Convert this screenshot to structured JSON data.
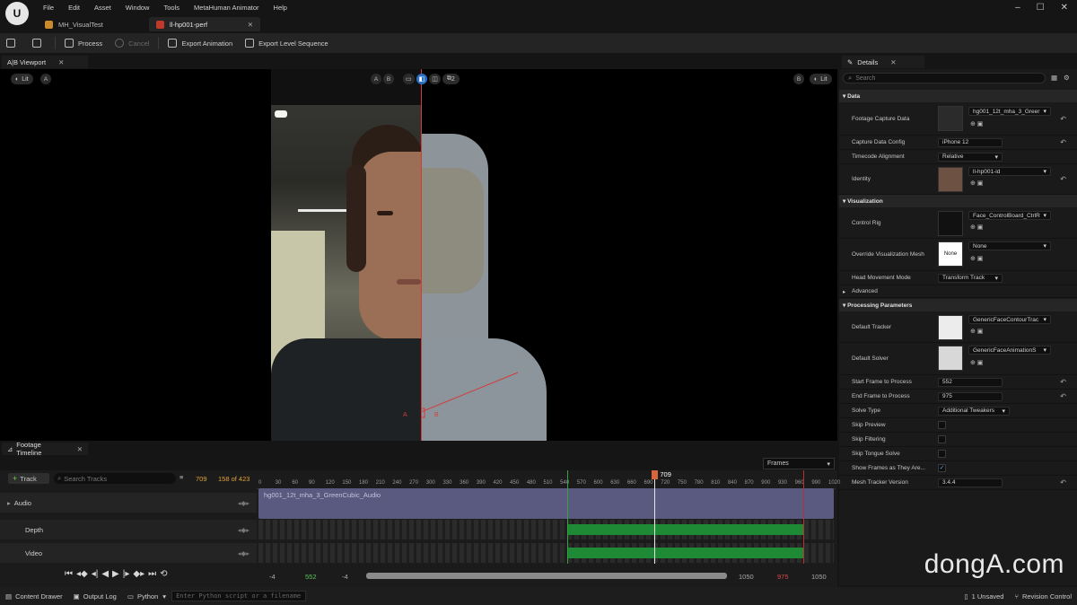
{
  "menu": [
    "File",
    "Edit",
    "Asset",
    "Window",
    "Tools",
    "MetaHuman Animator",
    "Help"
  ],
  "tabs": [
    {
      "label": "MH_VisualTest"
    },
    {
      "label": "ll-hp001-perf"
    }
  ],
  "toolbar": {
    "process": "Process",
    "cancel": "Cancel",
    "export_animation": "Export Animation",
    "export_level_sequence": "Export Level Sequence"
  },
  "viewport": {
    "tab_label": "A|B Viewport",
    "lit_left": "Lit",
    "badge_a": "A",
    "badge_b": "B",
    "ab_toggle_a": "A",
    "ab_toggle_b": "B",
    "camera_count": "2",
    "lit_right": "Lit",
    "marker_a": "A",
    "marker_b": "B"
  },
  "details": {
    "tab_label": "Details",
    "search_placeholder": "Search",
    "sections": {
      "data": "Data",
      "visualization": "Visualization",
      "advanced": "Advanced",
      "processing": "Processing Parameters"
    },
    "rows": {
      "footage_capture_data": {
        "label": "Footage Capture Data",
        "value": "hg001_12t_mha_3_Greer"
      },
      "capture_data_config": {
        "label": "Capture Data Config",
        "value": "iPhone 12"
      },
      "timecode_alignment": {
        "label": "Timecode Alignment",
        "value": "Relative"
      },
      "identity": {
        "label": "Identity",
        "value": "ll-hp001-id"
      },
      "control_rig": {
        "label": "Control Rig",
        "value": "Face_ControlBoard_CtrlR"
      },
      "override_mesh": {
        "label": "Override Visualization Mesh",
        "value": "None",
        "thumb": "None"
      },
      "head_movement": {
        "label": "Head Movement Mode",
        "value": "Transform Track"
      },
      "default_tracker": {
        "label": "Default Tracker",
        "value": "GenericFaceContourTrac"
      },
      "default_solver": {
        "label": "Default Solver",
        "value": "GenericFaceAnimationS"
      },
      "start_frame": {
        "label": "Start Frame to Process",
        "value": "552"
      },
      "end_frame": {
        "label": "End Frame to Process",
        "value": "975"
      },
      "solve_type": {
        "label": "Solve Type",
        "value": "Additional Tweakers"
      },
      "skip_preview": {
        "label": "Skip Preview"
      },
      "skip_filtering": {
        "label": "Skip Filtering"
      },
      "skip_tongue": {
        "label": "Skip Tongue Solve"
      },
      "show_frames": {
        "label": "Show Frames as They Are..."
      },
      "mesh_tracker_version": {
        "label": "Mesh Tracker Version",
        "value": "3.4.4"
      }
    }
  },
  "timeline": {
    "tab_label": "Footage Timeline",
    "add_track": "Track",
    "search_placeholder": "Search Tracks",
    "current_frame": "709",
    "frame_count": "158 of 423",
    "frames_dropdown": "Frames",
    "playhead": "709",
    "tracks": [
      {
        "label": "Audio"
      },
      {
        "label": "Depth"
      },
      {
        "label": "Video"
      }
    ],
    "audio_clip": "hg001_12t_mha_3_GreenCubic_Audio",
    "ruler": [
      "0",
      "30",
      "60",
      "90",
      "120",
      "150",
      "180",
      "210",
      "240",
      "270",
      "300",
      "330",
      "360",
      "390",
      "420",
      "450",
      "480",
      "510",
      "540",
      "570",
      "600",
      "630",
      "660",
      "690",
      "720",
      "750",
      "780",
      "810",
      "840",
      "870",
      "900",
      "930",
      "960",
      "990",
      "1020"
    ],
    "range_start_offset": "-4",
    "range_start": "552",
    "range_start_offset2": "-4",
    "range_end": "1050",
    "range_end_red": "975",
    "range_end2": "1050",
    "selection_start_frame": 552,
    "selection_end_frame": 975,
    "playhead_frame": 709
  },
  "statusbar": {
    "content_drawer": "Content Drawer",
    "output_log": "Output Log",
    "python": "Python",
    "cmd_placeholder": "Enter Python script or a filename",
    "unsaved": "1 Unsaved",
    "revision": "Revision Control"
  },
  "watermark": "dongA.com"
}
